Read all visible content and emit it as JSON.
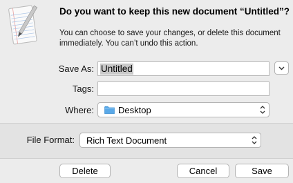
{
  "dialog": {
    "title": "Do you want to keep this new document “Untitled”?",
    "message": "You can choose to save your changes, or delete this document immediately. You can’t undo this action."
  },
  "form": {
    "save_as_label": "Save As:",
    "save_as_value": "Untitled",
    "tags_label": "Tags:",
    "tags_value": "",
    "where_label": "Where:",
    "where_value": "Desktop"
  },
  "options": {
    "file_format_label": "File Format:",
    "file_format_value": "Rich Text Document"
  },
  "buttons": {
    "delete": "Delete",
    "cancel": "Cancel",
    "save": "Save"
  },
  "icons": {
    "app": "textedit-document-icon",
    "expand": "chevron-down-icon",
    "folder": "folder-icon",
    "stepper": "up-down-arrows-icon"
  },
  "colors": {
    "background": "#ececec",
    "options_background": "#e3e3e3",
    "folder": "#5aa9e8",
    "selection": "#c9c9c9"
  }
}
